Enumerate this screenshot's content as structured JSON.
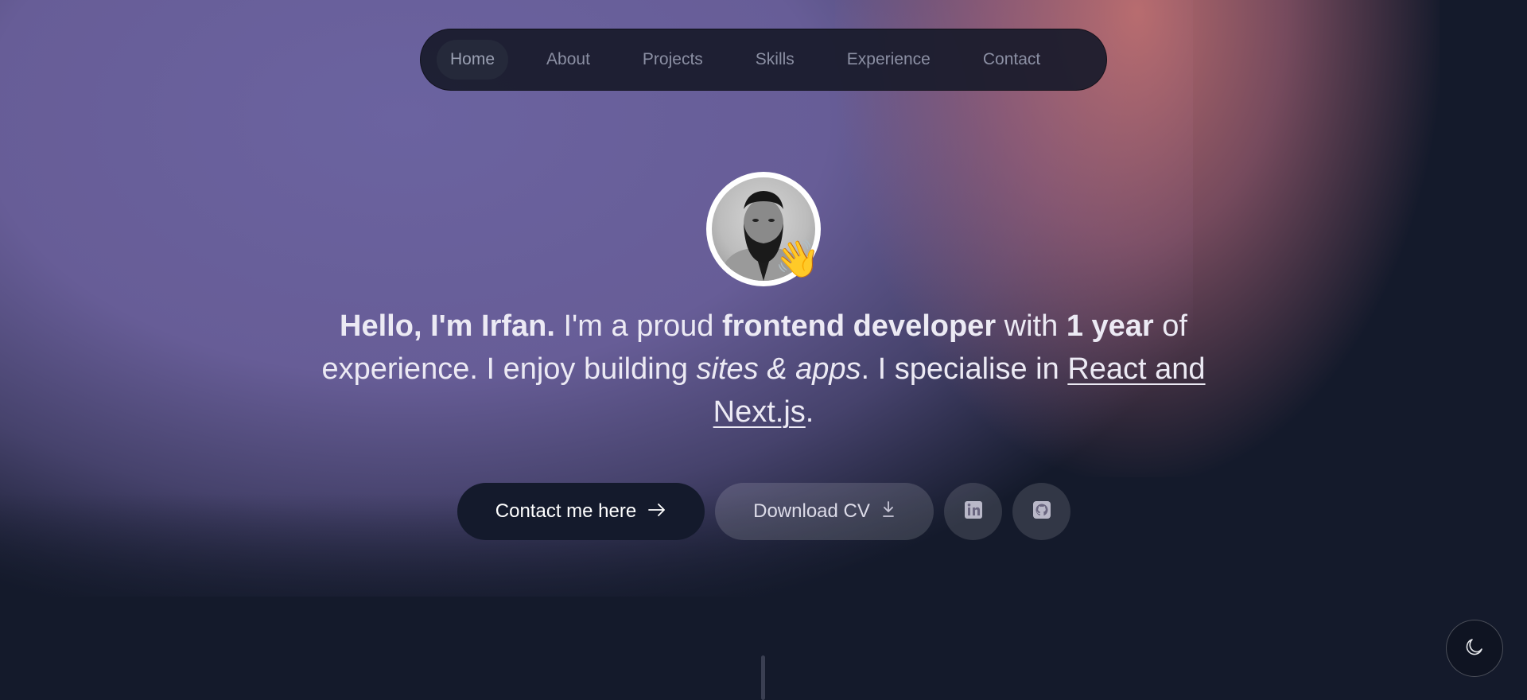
{
  "nav": {
    "items": [
      {
        "label": "Home"
      },
      {
        "label": "About"
      },
      {
        "label": "Projects"
      },
      {
        "label": "Skills"
      },
      {
        "label": "Experience"
      },
      {
        "label": "Contact"
      }
    ],
    "active": "Home"
  },
  "hero": {
    "avatar_icon": "profile-photo",
    "wave_emoji": "👋",
    "intro": {
      "greeting": "Hello, I'm Irfan.",
      "t1": " I'm a proud ",
      "role": "frontend developer",
      "t2": " with ",
      "years": "1 year",
      "t3": " of experience. I enjoy building ",
      "things": "sites & apps",
      "t4": ". I specialise in ",
      "stack": "React and Next.js",
      "t5": "."
    }
  },
  "actions": {
    "contact_label": "Contact me here",
    "contact_icon": "arrow-right-icon",
    "cv_label": "Download CV",
    "cv_icon": "download-icon",
    "linkedin_icon": "linkedin-icon",
    "github_icon": "github-icon"
  },
  "theme_toggle": {
    "icon": "moon-icon"
  },
  "colors": {
    "accent_dark": "#141a2c",
    "bg": "#141a2b",
    "purple": "#675d97",
    "pink": "#c77373"
  }
}
